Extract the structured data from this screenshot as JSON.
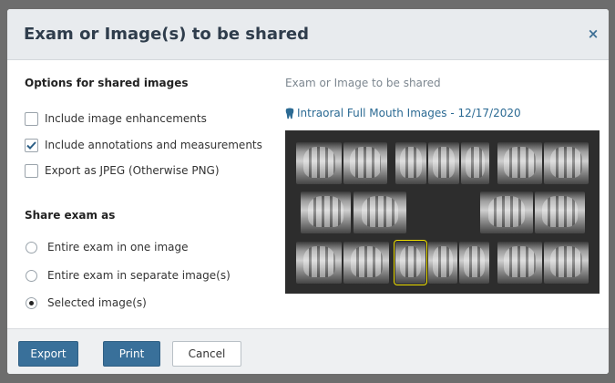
{
  "dialog": {
    "title": "Exam or Image(s) to be shared",
    "close_icon": "×"
  },
  "options": {
    "title": "Options for shared images",
    "items": [
      {
        "label": "Include image enhancements",
        "checked": false
      },
      {
        "label": "Include annotations and measurements",
        "checked": true
      },
      {
        "label": "Export as JPEG (Otherwise PNG)",
        "checked": false
      }
    ]
  },
  "share": {
    "title": "Share exam as",
    "items": [
      {
        "label": "Entire exam in one image",
        "selected": false
      },
      {
        "label": "Entire exam in separate image(s)",
        "selected": false
      },
      {
        "label": "Selected image(s)",
        "selected": true
      }
    ]
  },
  "preview": {
    "label": "Exam or Image to be shared",
    "exam_name": "Intraoral Full Mouth Images - 12/17/2020",
    "exam_icon": "tooth-icon",
    "selected_image": "bottom-row, third image"
  },
  "footer": {
    "export_label": "Export",
    "print_label": "Print",
    "cancel_label": "Cancel"
  },
  "colors": {
    "primary_button": "#39709a",
    "link": "#2b6a93",
    "selection_outline": "#f0e000"
  }
}
